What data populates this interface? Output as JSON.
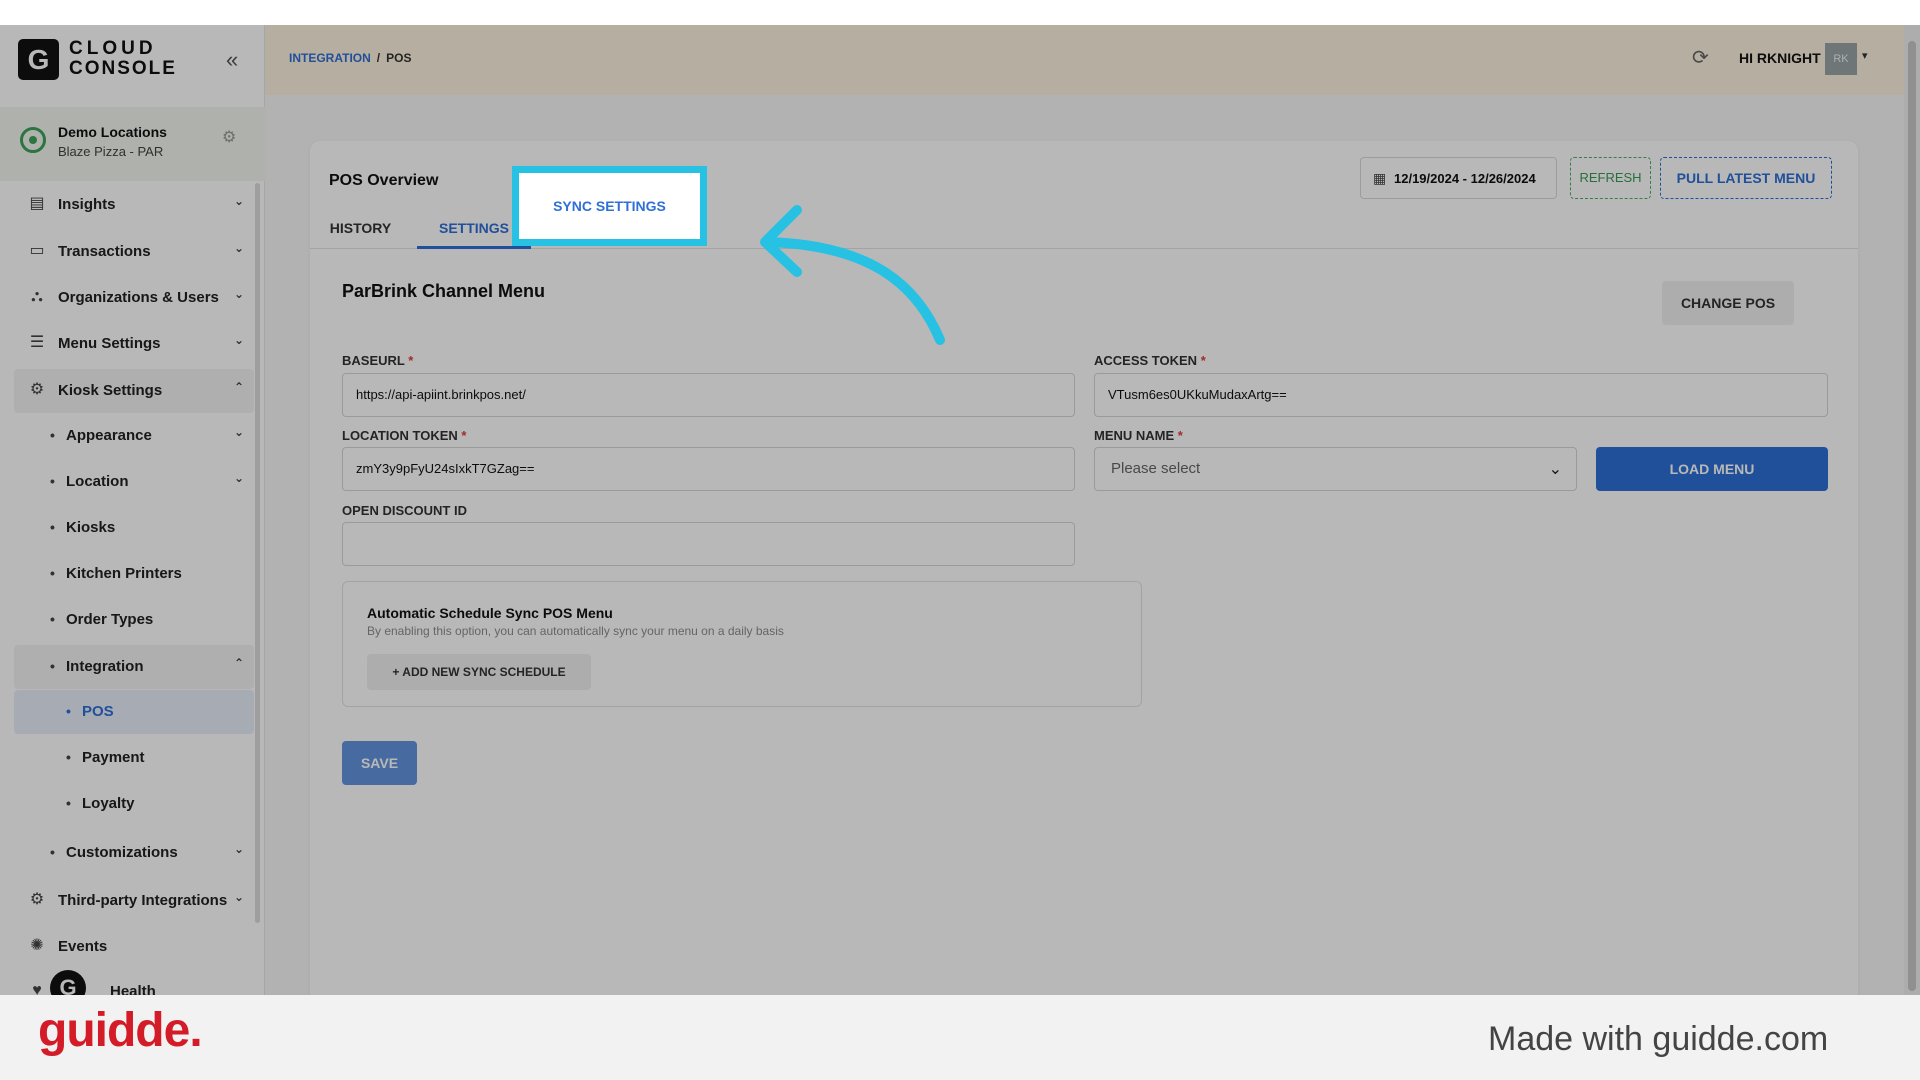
{
  "brand": {
    "logo_letter": "G",
    "name_line1": "CLOUD",
    "name_line2": "CONSOLE"
  },
  "location": {
    "title": "Demo Locations",
    "subtitle": "Blaze Pizza - PAR"
  },
  "sidebar": {
    "items": [
      {
        "label": "Insights",
        "icon": "chart-icon"
      },
      {
        "label": "Transactions",
        "icon": "receipt-icon"
      },
      {
        "label": "Organizations & Users",
        "icon": "org-tree-icon"
      },
      {
        "label": "Menu Settings",
        "icon": "menu-icon"
      },
      {
        "label": "Kiosk Settings",
        "icon": "gear-icon"
      },
      {
        "label": "Appearance"
      },
      {
        "label": "Location"
      },
      {
        "label": "Kiosks"
      },
      {
        "label": "Kitchen Printers"
      },
      {
        "label": "Order Types"
      },
      {
        "label": "Integration"
      },
      {
        "label": "POS"
      },
      {
        "label": "Payment"
      },
      {
        "label": "Loyalty"
      },
      {
        "label": "Customizations"
      },
      {
        "label": "Third-party Integrations",
        "icon": "gear-icon"
      },
      {
        "label": "Events",
        "icon": "events-icon"
      },
      {
        "label": "Health"
      }
    ]
  },
  "header": {
    "breadcrumb_parent": "INTEGRATION",
    "breadcrumb_sep": "/",
    "breadcrumb_current": "POS",
    "greeting": "HI RKNIGHT",
    "avatar_initials": "RK"
  },
  "card": {
    "title": "POS Overview",
    "date_range": "12/19/2024 - 12/26/2024",
    "refresh_label": "REFRESH",
    "pull_label": "PULL LATEST MENU",
    "tabs": [
      {
        "label": "HISTORY"
      },
      {
        "label": "SETTINGS"
      },
      {
        "label": "SYNC SETTINGS"
      }
    ]
  },
  "section": {
    "title": "ParBrink Channel Menu",
    "change_pos_label": "CHANGE POS",
    "baseurl_label": "BASEURL",
    "baseurl_value": "https://api-apiint.brinkpos.net/",
    "access_token_label": "ACCESS TOKEN",
    "access_token_value": "VTusm6es0UKkuMudaxArtg==",
    "location_token_label": "LOCATION TOKEN",
    "location_token_value": "zmY3y9pFyU24sIxkT7GZag==",
    "menu_name_label": "MENU NAME",
    "menu_name_placeholder": "Please select",
    "load_menu_label": "LOAD MENU",
    "open_discount_label": "OPEN DISCOUNT ID",
    "open_discount_value": "",
    "required_marker": "*"
  },
  "sync": {
    "title": "Automatic Schedule Sync POS Menu",
    "description": "By enabling this option, you can automatically sync your menu on a daily basis",
    "add_label": "+ ADD NEW SYNC SCHEDULE"
  },
  "save_label": "SAVE",
  "footer": {
    "brand": "guidde.",
    "tagline": "Made with guidde.com"
  },
  "colors": {
    "accent": "#2f6fd6",
    "highlight": "#27c1e3",
    "brand_red": "#d41c28",
    "success": "#3a9a55"
  }
}
